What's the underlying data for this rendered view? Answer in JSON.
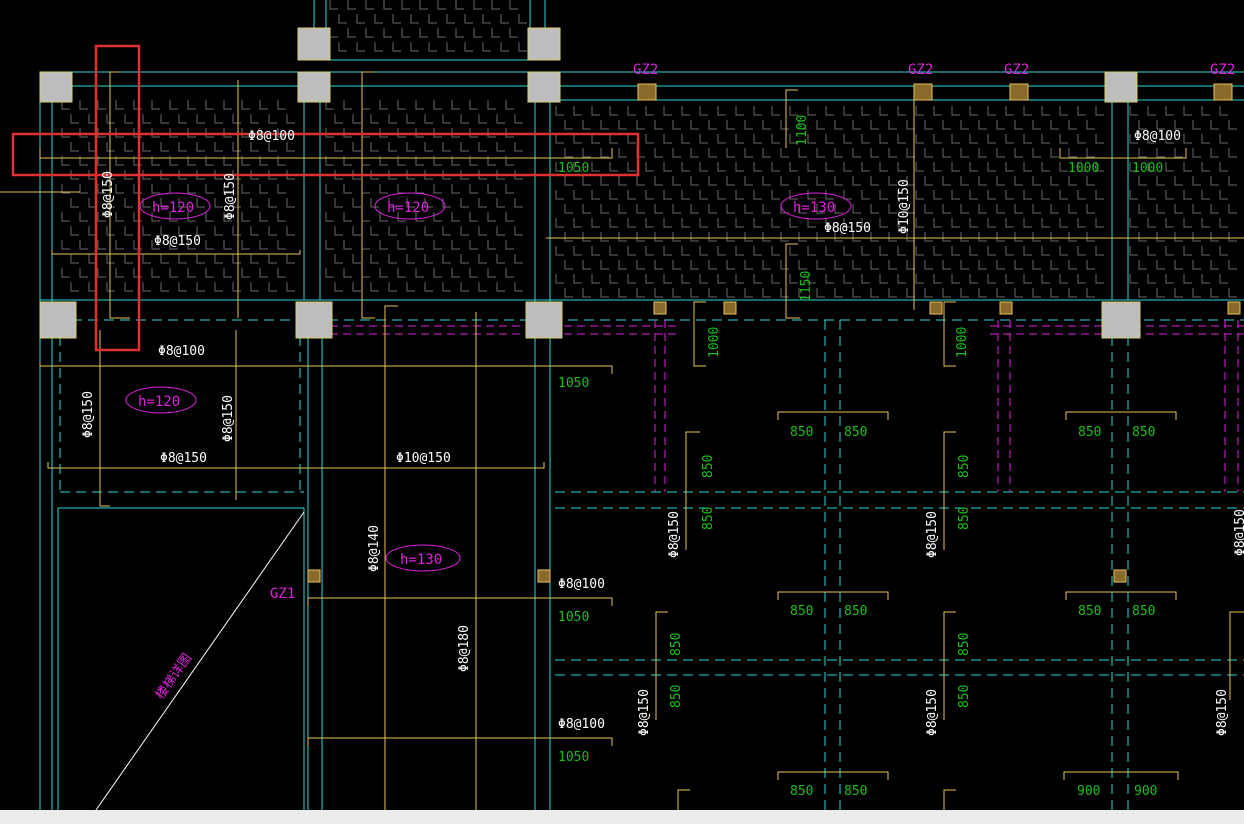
{
  "colors": {
    "background": "#000000",
    "wall": "#2ad7d7",
    "rebar": "#e8c25a",
    "dim": "#16c016",
    "label": "#ffffff",
    "magenta": "#e020e0",
    "column": "#bdbdbd",
    "highlight": "#e03030",
    "statusbar": "#ececec"
  },
  "labels": {
    "gz2": "GZ2",
    "gz1": "GZ1",
    "h120": "h=120",
    "h130": "h=130",
    "d8_100": "Φ8@100",
    "d8_150": "Φ8@150",
    "d10_150": "Φ10@150",
    "d8_140": "Φ8@140",
    "d8_180": "Φ8@180",
    "dim1050": "1050",
    "dim1000": "1000",
    "dim1100": "1100",
    "dim1150": "1150",
    "dim850": "850",
    "dim900": "900",
    "stair_text": "楼梯详图"
  },
  "icons": {
    "column": "concrete-column-icon",
    "constructional_column": "hatched-column-icon"
  }
}
